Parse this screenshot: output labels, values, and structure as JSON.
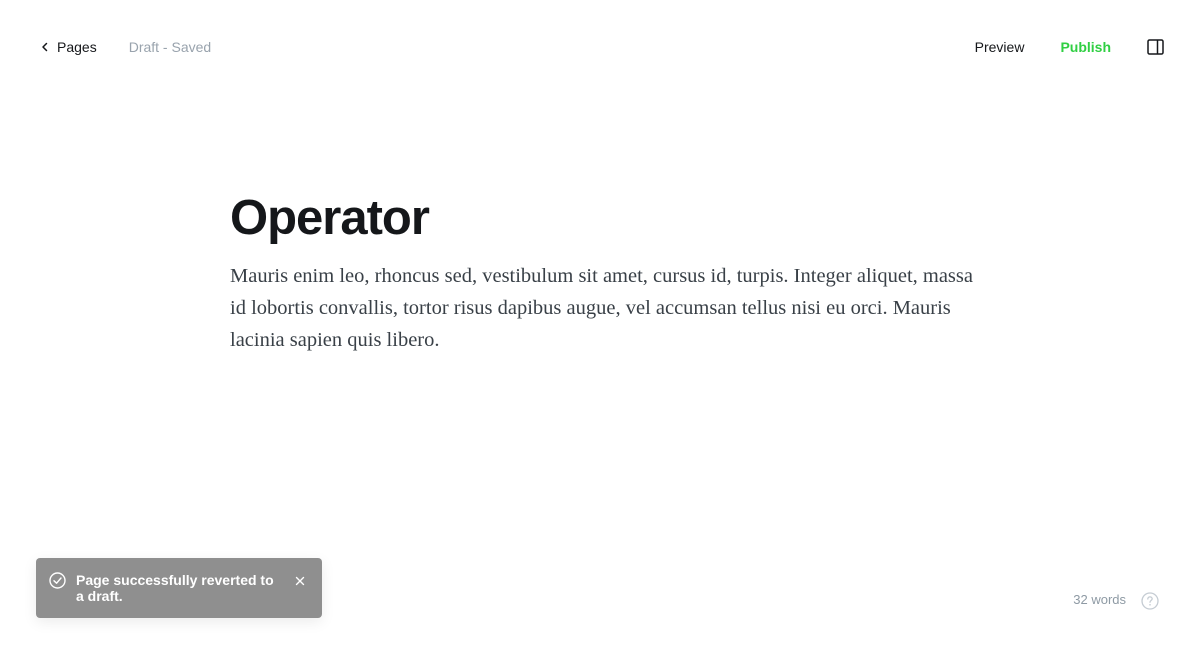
{
  "topbar": {
    "back_label": "Pages",
    "status": "Draft - Saved",
    "preview_label": "Preview",
    "publish_label": "Publish"
  },
  "editor": {
    "title": "Operator",
    "body": "Mauris enim leo, rhoncus sed, vestibulum sit amet, cursus id, turpis. Integer aliquet, massa id lobortis convallis, tortor risus dapibus augue, vel accumsan tellus nisi eu orci. Mauris lacinia sapien quis libero."
  },
  "toast": {
    "message": "Page successfully reverted to a draft."
  },
  "footer": {
    "word_count": "32 words"
  },
  "colors": {
    "publish": "#30cf43",
    "toast_bg": "#8f8f8f",
    "muted": "#99a3ad"
  },
  "icons": {
    "back": "chevron-left-icon",
    "sidebar": "sidebar-toggle-icon",
    "toast": "check-circle-icon",
    "close": "close-icon",
    "help": "help-circle-icon"
  }
}
